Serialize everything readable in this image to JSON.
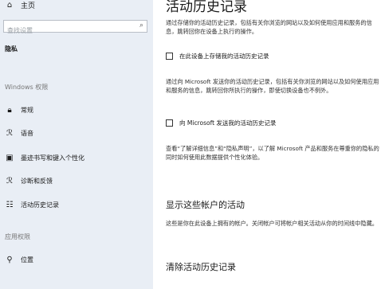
{
  "sidebar": {
    "home_label": "主页",
    "search_placeholder": "查找设置",
    "category_title": "隐私",
    "windows_section": "Windows 权限",
    "windows_items": [
      {
        "label": "常规",
        "icon": "lock-icon"
      },
      {
        "label": "语音",
        "icon": "speech-icon"
      },
      {
        "label": "墨迹书写和键入个性化",
        "icon": "pen-keyboard-icon"
      },
      {
        "label": "诊断和反馈",
        "icon": "feedback-icon"
      },
      {
        "label": "活动历史记录",
        "icon": "timeline-icon"
      }
    ],
    "app_section": "应用权限",
    "app_items": [
      {
        "label": "位置",
        "icon": "location-icon"
      }
    ]
  },
  "main": {
    "title": "活动历史记录",
    "intro": "通过存储你的活动历史记录，包括有关你浏览的网站以及如何使用应用和服务的信息，跳转回你在设备上执行的操作。",
    "checkbox_store_label": "在此设备上存储我的活动历史记录",
    "send_desc": "通过向 Microsoft 发送你的活动历史记录，包括有关你浏览的网站以及如何使用应用和服务的信息，跳转回你所执行的操作，即使切换设备也不例外。",
    "checkbox_send_label": "向 Microsoft 发送我的活动历史记录",
    "privacy_note": "查看“了解详细信息”和“隐私声明”，以了解 Microsoft 产品和服务在尊重你的隐私的同时如何使用此数据提供个性化体验。",
    "accounts_title": "显示这些帐户的活动",
    "accounts_desc": "这些是你在此设备上拥有的帐户。关闭帐户可将帐户相关活动从你的时间线中隐藏。",
    "clear_title": "清除活动历史记录"
  }
}
